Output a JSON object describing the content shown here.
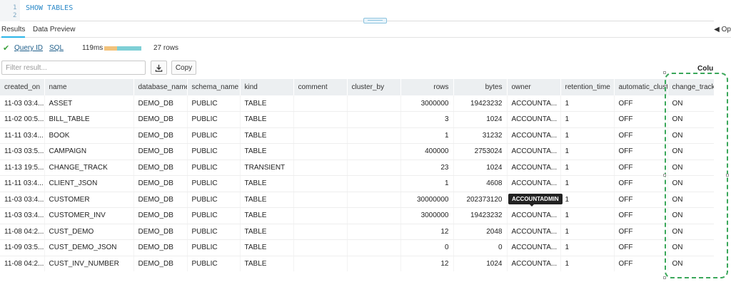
{
  "editor": {
    "lines": [
      {
        "number": "1",
        "code": "SHOW TABLES"
      },
      {
        "number": "2",
        "code": ""
      }
    ]
  },
  "tabs": [
    {
      "label": "Results",
      "active": true
    },
    {
      "label": "Data Preview",
      "active": false
    }
  ],
  "tab_right": "Op",
  "stats": {
    "query_id_label": "Query ID",
    "sql_label": "SQL",
    "duration": "119ms",
    "rows": "27 rows",
    "progress_fraction": 0.34
  },
  "toolbar": {
    "filter_placeholder": "Filter result...",
    "download_icon": "download-icon",
    "copy_label": "Copy",
    "columns_label": "Colu"
  },
  "table": {
    "columns": [
      "created_on",
      "name",
      "database_name",
      "schema_name",
      "kind",
      "comment",
      "cluster_by",
      "rows",
      "bytes",
      "owner",
      "retention_time",
      "automatic_clustering",
      "change_tracking"
    ],
    "numeric_columns": [
      7,
      8
    ],
    "rows": [
      [
        "11-03 03:4...",
        "ASSET",
        "DEMO_DB",
        "PUBLIC",
        "TABLE",
        "",
        "",
        "3000000",
        "19423232",
        "ACCOUNTA...",
        "1",
        "OFF",
        "ON"
      ],
      [
        "11-02 00:5...",
        "BILL_TABLE",
        "DEMO_DB",
        "PUBLIC",
        "TABLE",
        "",
        "",
        "3",
        "1024",
        "ACCOUNTA...",
        "1",
        "OFF",
        "ON"
      ],
      [
        "11-11 03:4...",
        "BOOK",
        "DEMO_DB",
        "PUBLIC",
        "TABLE",
        "",
        "",
        "1",
        "31232",
        "ACCOUNTA...",
        "1",
        "OFF",
        "ON"
      ],
      [
        "11-03 03:5...",
        "CAMPAIGN",
        "DEMO_DB",
        "PUBLIC",
        "TABLE",
        "",
        "",
        "400000",
        "2753024",
        "ACCOUNTA...",
        "1",
        "OFF",
        "ON"
      ],
      [
        "11-13 19:5...",
        "CHANGE_TRACK",
        "DEMO_DB",
        "PUBLIC",
        "TRANSIENT",
        "",
        "",
        "23",
        "1024",
        "ACCOUNTA...",
        "1",
        "OFF",
        "ON"
      ],
      [
        "11-11 03:4...",
        "CLIENT_JSON",
        "DEMO_DB",
        "PUBLIC",
        "TABLE",
        "",
        "",
        "1",
        "4608",
        "ACCOUNTA...",
        "1",
        "OFF",
        "ON"
      ],
      [
        "11-03 03:4...",
        "CUSTOMER",
        "DEMO_DB",
        "PUBLIC",
        "TABLE",
        "",
        "",
        "30000000",
        "202373120",
        "ACCOUNTA...",
        "1",
        "OFF",
        "ON"
      ],
      [
        "11-03 03:4...",
        "CUSTOMER_INV",
        "DEMO_DB",
        "PUBLIC",
        "TABLE",
        "",
        "",
        "3000000",
        "19423232",
        "ACCOUNTA...",
        "1",
        "OFF",
        "ON"
      ],
      [
        "11-08 04:2...",
        "CUST_DEMO",
        "DEMO_DB",
        "PUBLIC",
        "TABLE",
        "",
        "",
        "12",
        "2048",
        "ACCOUNTA...",
        "1",
        "OFF",
        "ON"
      ],
      [
        "11-09 03:5...",
        "CUST_DEMO_JSON",
        "DEMO_DB",
        "PUBLIC",
        "TABLE",
        "",
        "",
        "0",
        "0",
        "ACCOUNTA...",
        "1",
        "OFF",
        "ON"
      ],
      [
        "11-08 04:2...",
        "CUST_INV_NUMBER",
        "DEMO_DB",
        "PUBLIC",
        "TABLE",
        "",
        "",
        "12",
        "1024",
        "ACCOUNTA...",
        "1",
        "OFF",
        "ON"
      ]
    ]
  },
  "tooltip": "ACCOUNTADMIN",
  "colors": {
    "accent": "#29b5e8",
    "success": "#3ca13c",
    "highlight": "#3aa75a",
    "header_bg": "#eceff1"
  }
}
